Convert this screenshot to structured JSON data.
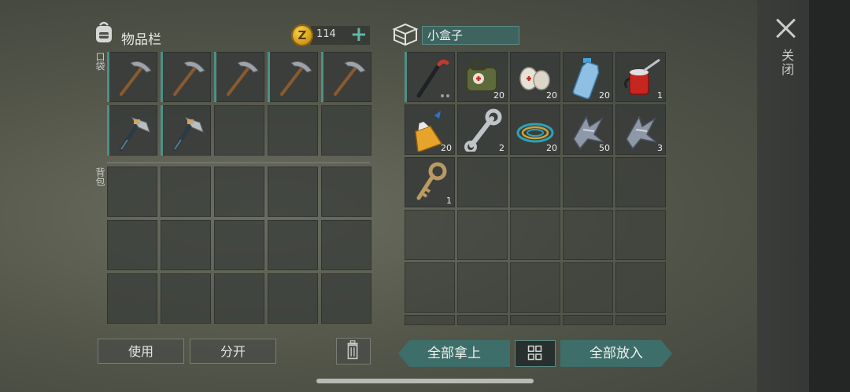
{
  "inventory": {
    "title": "物品栏",
    "coins": "114",
    "coin_symbol": "Z",
    "pocket_label": "口袋",
    "backpack_label": "背包",
    "pocket_items": [
      {
        "item": "pickaxe-icon"
      },
      {
        "item": "pickaxe-icon"
      },
      {
        "item": "pickaxe-icon"
      },
      {
        "item": "pickaxe-icon"
      },
      {
        "item": "pickaxe-icon"
      },
      {
        "item": "hatchet-icon"
      },
      {
        "item": "hatchet-icon"
      }
    ],
    "use_button": "使用",
    "split_button": "分开"
  },
  "container": {
    "name": "小盒子",
    "items": [
      {
        "item": "crowbar-icon",
        "count": ""
      },
      {
        "item": "medkit-bag-icon",
        "count": "20"
      },
      {
        "item": "bandage-icon",
        "count": "20"
      },
      {
        "item": "water-bottle-icon",
        "count": "20"
      },
      {
        "item": "oil-can-icon",
        "count": "1"
      },
      {
        "item": "glue-icon",
        "count": "20"
      },
      {
        "item": "wrench-icon",
        "count": "2"
      },
      {
        "item": "wire-coil-icon",
        "count": "20"
      },
      {
        "item": "scrap-metal-icon",
        "count": "50"
      },
      {
        "item": "scrap-metal-icon",
        "count": "3"
      },
      {
        "item": "key-icon",
        "count": "1"
      }
    ],
    "take_all_button": "全部拿上",
    "put_all_button": "全部放入"
  },
  "close_label": "关闭",
  "colors": {
    "accent": "#3e6e69",
    "highlight": "#4f8f86",
    "coin": "#e8b62a"
  }
}
